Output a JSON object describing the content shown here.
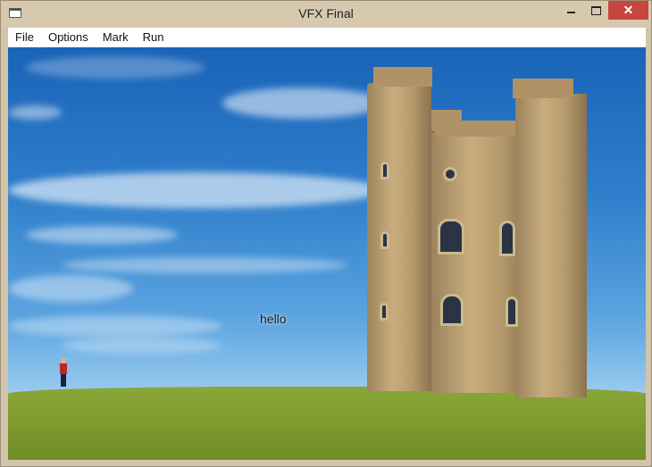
{
  "window": {
    "title": "VFX Final",
    "close_glyph": "✕"
  },
  "menu": {
    "items": [
      {
        "label": "File"
      },
      {
        "label": "Options"
      },
      {
        "label": "Mark"
      },
      {
        "label": "Run"
      }
    ]
  },
  "canvas": {
    "overlay_text": "hello",
    "sky_color": "#2f7ecb",
    "grass_color": "#7e9c2f"
  }
}
